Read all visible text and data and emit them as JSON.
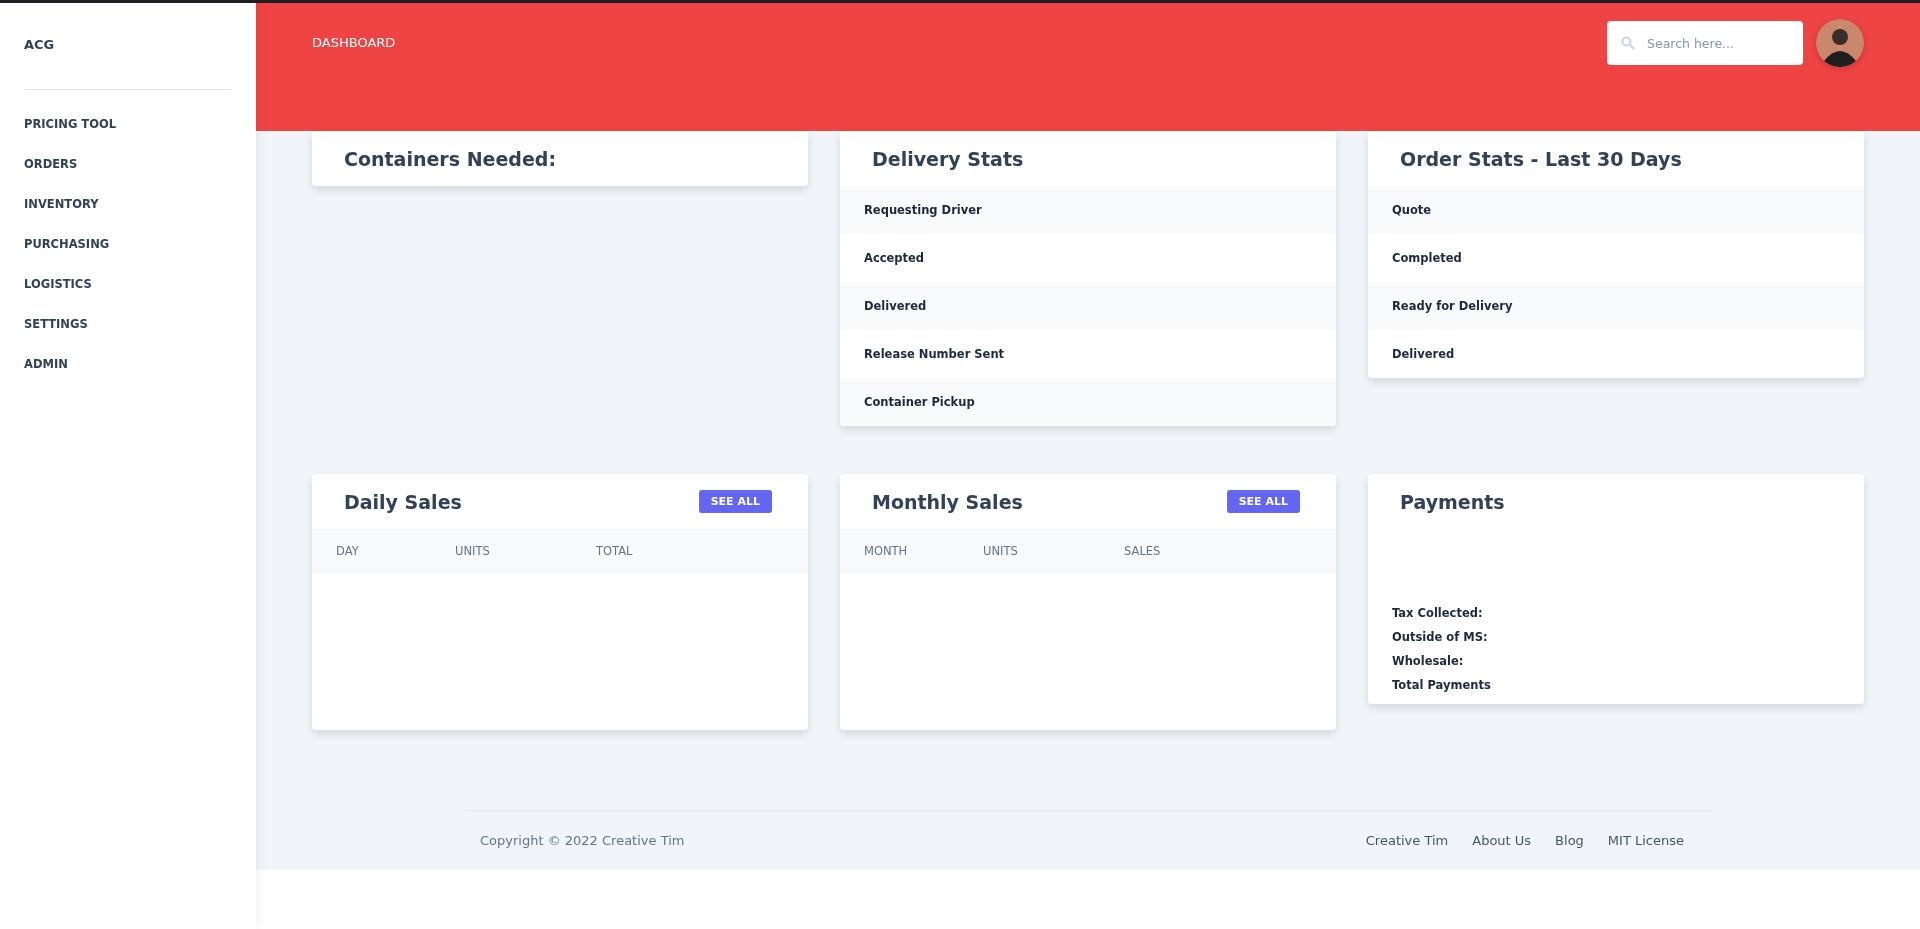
{
  "sidebar": {
    "brand": "ACG",
    "items": [
      {
        "label": "PRICING TOOL"
      },
      {
        "label": "ORDERS"
      },
      {
        "label": "INVENTORY"
      },
      {
        "label": "PURCHASING"
      },
      {
        "label": "LOGISTICS"
      },
      {
        "label": "SETTINGS"
      },
      {
        "label": "ADMIN"
      }
    ]
  },
  "header": {
    "title": "DASHBOARD",
    "search": {
      "placeholder": "Search here..."
    }
  },
  "top_cards": [
    {
      "kind": "plain",
      "title": "Containers Needed:"
    },
    {
      "kind": "list",
      "title": "Delivery Stats",
      "rows": [
        "Requesting Driver",
        "Accepted",
        "Delivered",
        "Release Number Sent",
        "Container Pickup"
      ]
    },
    {
      "kind": "list",
      "title": "Order Stats - Last 30 Days",
      "rows": [
        "Quote",
        "Completed",
        "Ready for Delivery",
        "Delivered"
      ]
    }
  ],
  "bottom_cards": [
    {
      "kind": "table",
      "title": "Daily Sales",
      "button": "SEE ALL",
      "columns": [
        "DAY",
        "UNITS",
        "TOTAL"
      ]
    },
    {
      "kind": "table",
      "title": "Monthly Sales",
      "button": "SEE ALL",
      "columns": [
        "MONTH",
        "UNITS",
        "SALES"
      ]
    },
    {
      "kind": "summary",
      "title": "Payments",
      "lines": [
        "Tax Collected:",
        "Outside of MS:",
        "Wholesale:",
        "Total Payments"
      ]
    }
  ],
  "footer": {
    "copyright": "Copyright © 2022 Creative Tim",
    "links": [
      "Creative Tim",
      "About Us",
      "Blog",
      "MIT License"
    ]
  }
}
